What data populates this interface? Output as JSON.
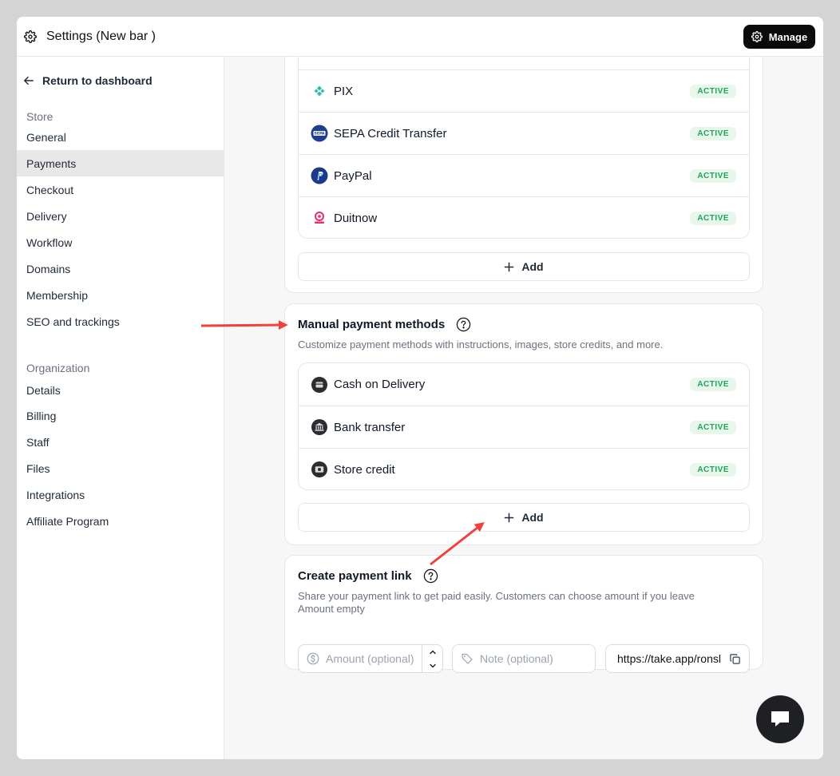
{
  "topbar": {
    "title": "Settings (New bar )",
    "manage_label": "Manage"
  },
  "sidebar": {
    "back_label": "Return to dashboard",
    "store_label": "Store",
    "store_items": [
      "General",
      "Payments",
      "Checkout",
      "Delivery",
      "Workflow",
      "Domains",
      "Membership",
      "SEO and trackings"
    ],
    "active_item": "Payments",
    "org_label": "Organization",
    "org_items": [
      "Details",
      "Billing",
      "Staff",
      "Files",
      "Integrations",
      "Affiliate Program"
    ]
  },
  "online_methods": {
    "items": [
      {
        "name": "PIX",
        "status": "ACTIVE",
        "icon": "pix-icon"
      },
      {
        "name": "SEPA Credit Transfer",
        "status": "ACTIVE",
        "icon": "sepa-icon"
      },
      {
        "name": "PayPal",
        "status": "ACTIVE",
        "icon": "paypal-icon"
      },
      {
        "name": "Duitnow",
        "status": "ACTIVE",
        "icon": "duitnow-icon"
      }
    ],
    "add_label": "Add"
  },
  "manual_methods": {
    "title": "Manual payment methods",
    "description": "Customize payment methods with instructions, images, store credits, and more.",
    "items": [
      {
        "name": "Cash on Delivery",
        "status": "ACTIVE",
        "icon": "cash-icon"
      },
      {
        "name": "Bank transfer",
        "status": "ACTIVE",
        "icon": "bank-icon"
      },
      {
        "name": "Store credit",
        "status": "ACTIVE",
        "icon": "store-credit-icon"
      }
    ],
    "add_label": "Add"
  },
  "payment_link": {
    "title": "Create payment link",
    "description_line1": "Share your payment link to get paid easily. Customers can choose amount if you leave",
    "description_line2": "Amount empty",
    "amount_placeholder": "Amount (optional)",
    "note_placeholder": "Note (optional)",
    "link_value": "https://take.app/ronsl"
  },
  "colors": {
    "badge_bg": "#e8f7ec",
    "badge_text": "#22a35a",
    "annotation_arrow": "#f0413a"
  }
}
